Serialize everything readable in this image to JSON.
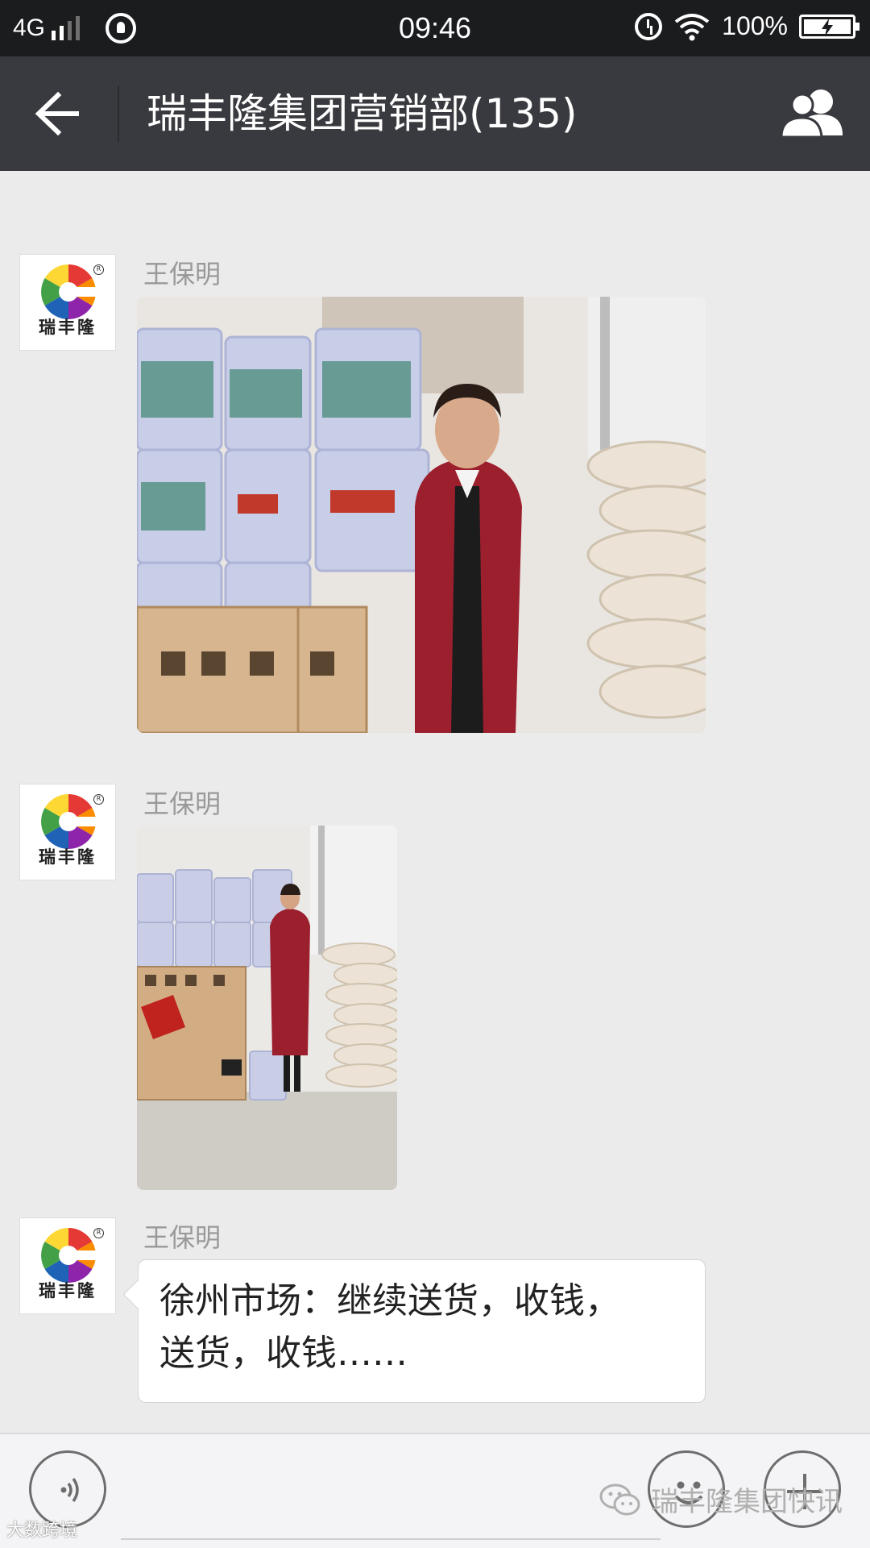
{
  "status_bar": {
    "network": "4G",
    "time": "09:46",
    "battery": "100%",
    "icons": [
      "signal-icon",
      "notification-bell-icon",
      "alarm-icon",
      "wifi-icon",
      "battery-charging-icon"
    ]
  },
  "header": {
    "title": "瑞丰隆集团营销部(135)",
    "back_icon": "back-arrow-icon",
    "members_icon": "group-members-icon"
  },
  "messages": [
    {
      "sender": "王保明",
      "avatar_brand": "瑞丰隆",
      "avatar_mark": "R",
      "type": "image",
      "image_subject": "warehouse-photo-paint-buckets-woman"
    },
    {
      "sender": "王保明",
      "avatar_brand": "瑞丰隆",
      "avatar_mark": "R",
      "type": "image",
      "image_subject": "warehouse-photo-full-length"
    },
    {
      "sender": "王保明",
      "avatar_brand": "瑞丰隆",
      "avatar_mark": "R",
      "type": "text",
      "text_line1": "徐州市场：继续送货，收钱，",
      "text_line2": "送货，收钱……"
    }
  ],
  "input_bar": {
    "voice_icon": "voice-input-icon",
    "emoji_icon": "emoji-icon",
    "plus_icon": "plus-icon"
  },
  "watermarks": {
    "bottom_left": "大数跨境",
    "bottom_right": "瑞丰隆集团快讯"
  },
  "colors": {
    "title_bar": "#393a3f",
    "status_bar": "#1b1c1e",
    "chat_background": "#ebebeb",
    "sender_name": "#999999"
  }
}
